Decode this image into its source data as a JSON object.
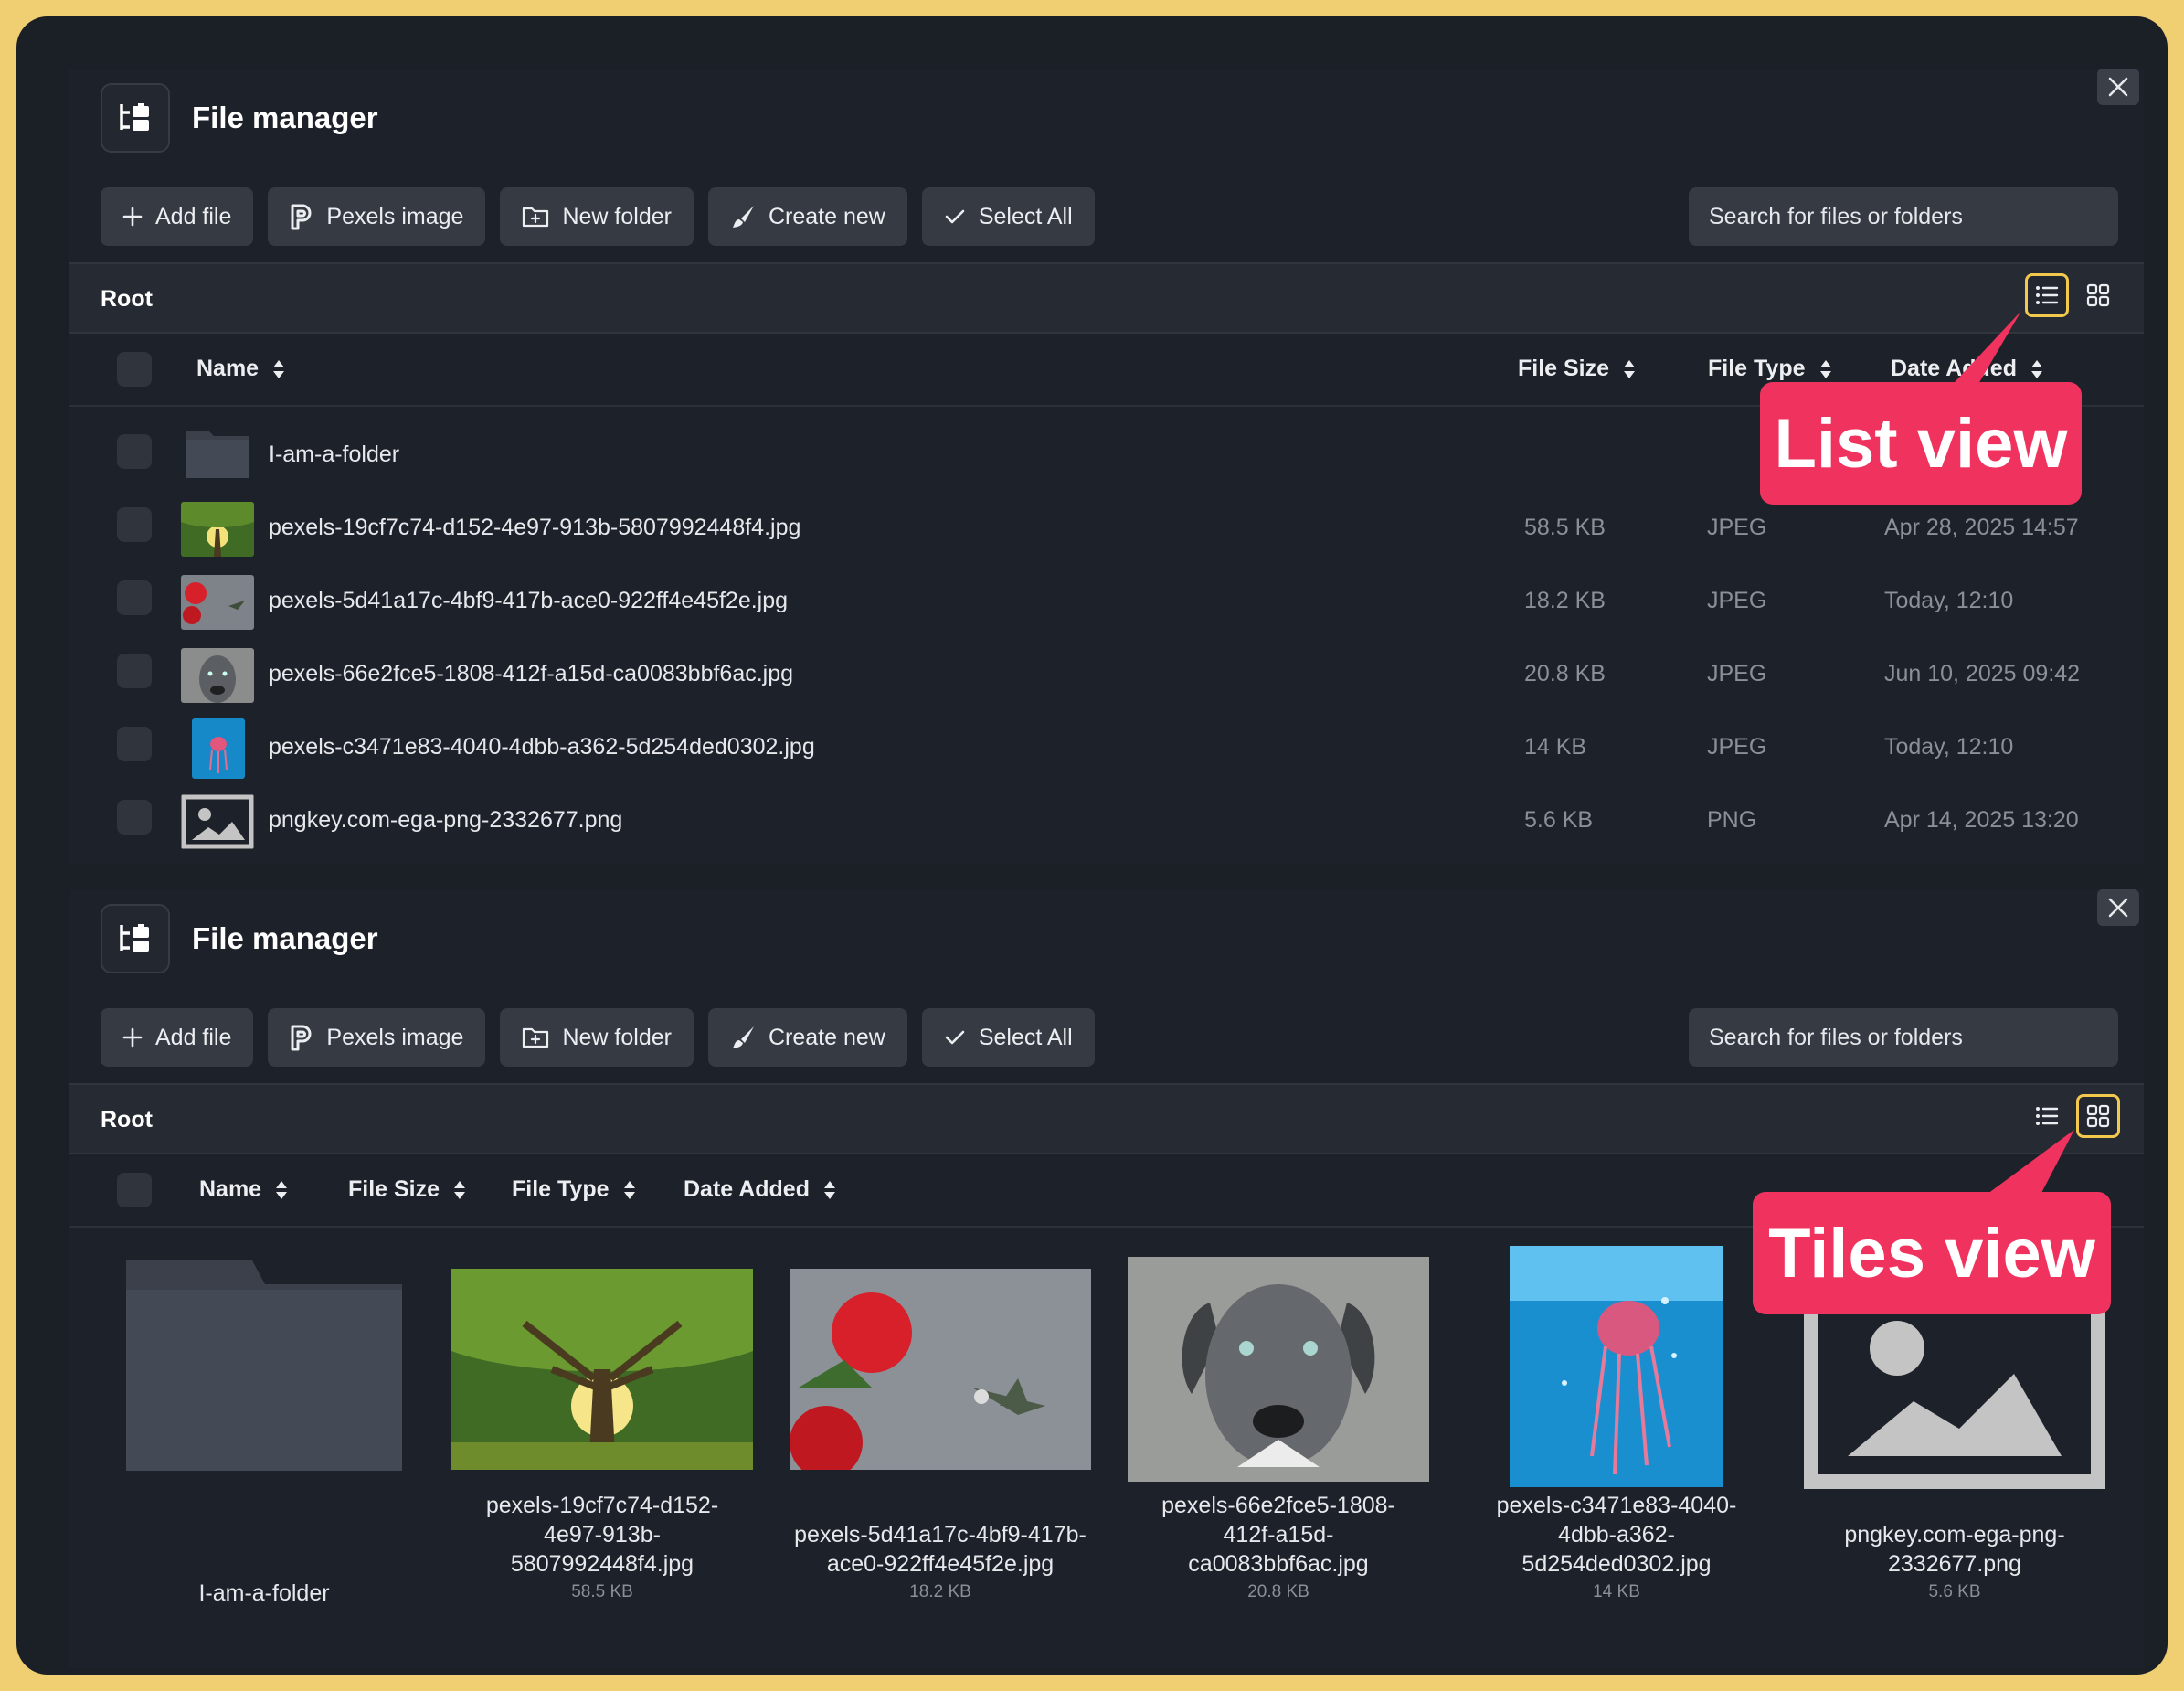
{
  "panels": [
    {
      "title": "File manager",
      "toolbar": {
        "add_file": "Add file",
        "pexels_image": "Pexels image",
        "new_folder": "New folder",
        "create_new": "Create new",
        "select_all": "Select All"
      },
      "search_placeholder": "Search for files or folders",
      "breadcrumb": "Root",
      "active_view": "list",
      "columns": {
        "name": "Name",
        "file_size": "File Size",
        "file_type": "File Type",
        "date_added": "Date Added"
      },
      "rows": [
        {
          "name": "I-am-a-folder",
          "size": "",
          "type": "",
          "date": "",
          "kind": "folder"
        },
        {
          "name": "pexels-19cf7c74-d152-4e97-913b-5807992448f4.jpg",
          "size": "58.5 KB",
          "type": "JPEG",
          "date": "Apr 28, 2025 14:57",
          "kind": "tree"
        },
        {
          "name": "pexels-5d41a17c-4bf9-417b-ace0-922ff4e45f2e.jpg",
          "size": "18.2 KB",
          "type": "JPEG",
          "date": "Today, 12:10",
          "kind": "flower"
        },
        {
          "name": "pexels-66e2fce5-1808-412f-a15d-ca0083bbf6ac.jpg",
          "size": "20.8 KB",
          "type": "JPEG",
          "date": "Jun 10, 2025 09:42",
          "kind": "dog"
        },
        {
          "name": "pexels-c3471e83-4040-4dbb-a362-5d254ded0302.jpg",
          "size": "14 KB",
          "type": "JPEG",
          "date": "Today, 12:10",
          "kind": "jelly"
        },
        {
          "name": "pngkey.com-ega-png-2332677.png",
          "size": "5.6 KB",
          "type": "PNG",
          "date": "Apr 14, 2025 13:20",
          "kind": "placeholder"
        }
      ]
    },
    {
      "title": "File manager",
      "toolbar": {
        "add_file": "Add file",
        "pexels_image": "Pexels image",
        "new_folder": "New folder",
        "create_new": "Create new",
        "select_all": "Select All"
      },
      "search_placeholder": "Search for files or folders",
      "breadcrumb": "Root",
      "active_view": "tiles",
      "columns": {
        "name": "Name",
        "file_size": "File Size",
        "file_type": "File Type",
        "date_added": "Date Added"
      },
      "tiles": [
        {
          "name_lines": [
            "I-am-a-folder"
          ],
          "size": "",
          "kind": "folder"
        },
        {
          "name_lines": [
            "pexels-19cf7c74-d152-",
            "4e97-913b-",
            "5807992448f4.jpg"
          ],
          "size": "58.5 KB",
          "kind": "tree"
        },
        {
          "name_lines": [
            "pexels-5d41a17c-4bf9-417b-",
            "ace0-922ff4e45f2e.jpg"
          ],
          "size": "18.2 KB",
          "kind": "flower"
        },
        {
          "name_lines": [
            "pexels-66e2fce5-1808-",
            "412f-a15d-",
            "ca0083bbf6ac.jpg"
          ],
          "size": "20.8 KB",
          "kind": "dog"
        },
        {
          "name_lines": [
            "pexels-c3471e83-4040-",
            "4dbb-a362-",
            "5d254ded0302.jpg"
          ],
          "size": "14 KB",
          "kind": "jelly"
        },
        {
          "name_lines": [
            "pngkey.com-ega-png-",
            "2332677.png"
          ],
          "size": "5.6 KB",
          "kind": "placeholder"
        }
      ]
    }
  ],
  "callouts": {
    "list": "List view",
    "tiles": "Tiles view"
  },
  "colors": {
    "accent": "#f2c94c",
    "callout": "#f0335e",
    "background": "#1d2129",
    "frame": "#f0cf73"
  }
}
